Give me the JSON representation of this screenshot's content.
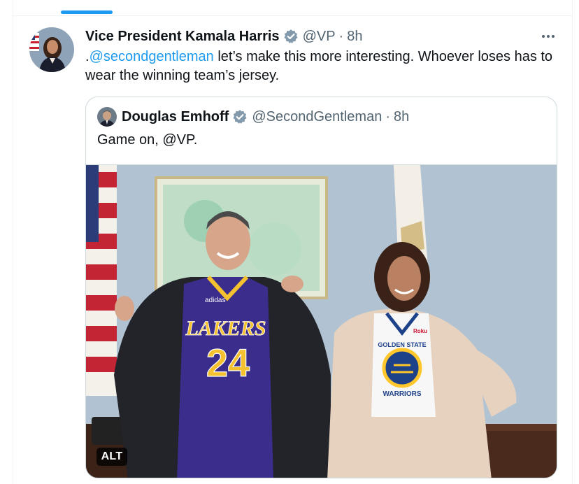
{
  "post": {
    "author_name": "Vice President Kamala Harris",
    "handle": "@VP",
    "separator": "·",
    "time": "8h",
    "text_prefix": ".",
    "mention": "@secondgentleman",
    "text_body": " let’s make this more interesting. Whoever loses has to wear the winning team’s jersey."
  },
  "quote": {
    "author_name": "Douglas Emhoff",
    "handle": "@SecondGentleman",
    "separator": "·",
    "time": "8h",
    "text": "Game on, @VP.",
    "alt_label": "ALT",
    "photo_text": {
      "jersey_team": "LAKERS",
      "jersey_number": "24",
      "jersey_brand": "adidas",
      "warriors_top": "GOLDEN STATE",
      "warriors_bottom": "WARRIORS",
      "sponsor": "Roku"
    }
  },
  "icons": [
    "verified-badge-icon",
    "more-options-icon",
    "avatar-vp",
    "avatar-emhoff"
  ],
  "colors": {
    "accent": "#1d9bf0",
    "secondary_text": "#536471",
    "border": "#cfd9de",
    "lakers_purple": "#3a2d8c",
    "lakers_gold": "#f5c12e",
    "warriors_blue": "#1d428a",
    "warriors_gold": "#ffc72c"
  }
}
